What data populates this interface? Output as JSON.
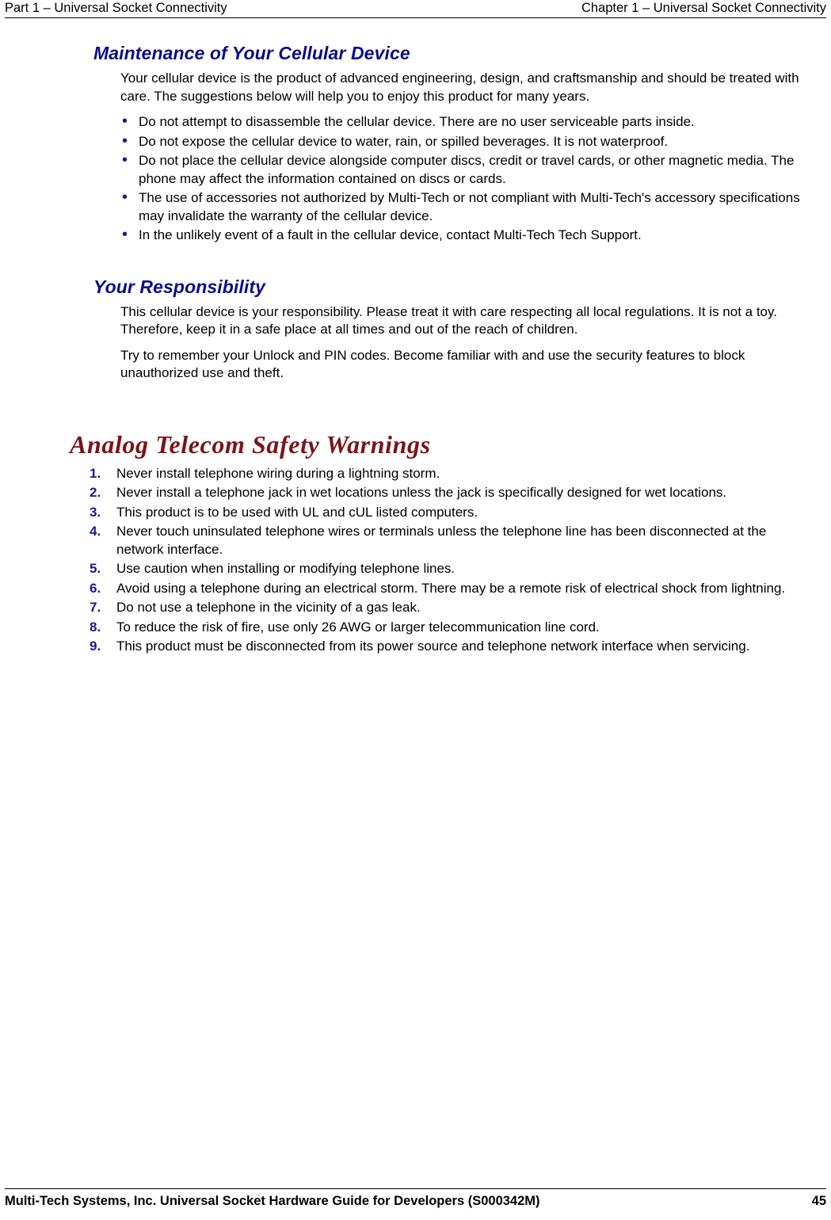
{
  "colors": {
    "heading_blue": "#0b0b8c",
    "title_maroon": "#7b1418",
    "marker_blue": "#1a1a8c",
    "text_black": "#000000",
    "page_background": "#ffffff"
  },
  "header": {
    "left": "Part 1 – Universal Socket Connectivity",
    "right": "Chapter 1 – Universal Socket Connectivity"
  },
  "footer": {
    "left": "Multi-Tech Systems, Inc. Universal Socket Hardware Guide for Developers (S000342M)",
    "page_number": "45"
  },
  "sections": {
    "maintenance": {
      "heading": "Maintenance of Your Cellular Device",
      "intro": "Your cellular device is the product of advanced engineering, design, and craftsmanship and should be treated with care. The suggestions below will help you to enjoy this product for many years.",
      "bullet_glyph": "•",
      "bullets": [
        "Do not attempt to disassemble the cellular device. There are no user serviceable parts inside.",
        "Do not expose the cellular device to water, rain, or spilled beverages. It is not waterproof.",
        "Do not place the cellular device alongside computer discs, credit or travel cards, or other magnetic media. The phone may affect the information contained on discs or cards.",
        "The use of accessories not authorized by Multi-Tech or not compliant with Multi-Tech's accessory specifications may invalidate the warranty of the cellular device.",
        "In the unlikely event of a fault in the cellular device, contact Multi-Tech Tech Support."
      ]
    },
    "responsibility": {
      "heading": "Your Responsibility",
      "paragraphs": [
        "This cellular device is your responsibility. Please treat it with care respecting all local regulations. It is not a toy. Therefore, keep it in a safe place at all times and out of the reach of children.",
        "Try to remember your Unlock and PIN codes. Become familiar with and use the security features to block unauthorized use and theft."
      ]
    },
    "safety_warnings": {
      "title": "Analog Telecom Safety Warnings",
      "items": [
        {
          "number": "1.",
          "text": "Never install telephone wiring during a lightning storm."
        },
        {
          "number": "2.",
          "text": "Never install a telephone jack in wet locations unless the jack is specifically designed for wet locations."
        },
        {
          "number": "3.",
          "text": "This product is to be used with UL and cUL listed computers."
        },
        {
          "number": "4.",
          "text": "Never touch uninsulated telephone wires or terminals unless the telephone line has been disconnected at the network interface."
        },
        {
          "number": "5.",
          "text": "Use caution when installing or modifying telephone lines."
        },
        {
          "number": "6.",
          "text": "Avoid using a telephone during an electrical storm. There may be a remote risk of electrical shock from lightning."
        },
        {
          "number": "7.",
          "text": "Do not use a telephone in the vicinity of a gas leak."
        },
        {
          "number": "8.",
          "text": "To reduce the risk of fire, use only 26 AWG or larger telecommunication line cord."
        },
        {
          "number": "9.",
          "text": "This product must be disconnected from its power source and telephone network interface when servicing."
        }
      ]
    }
  }
}
